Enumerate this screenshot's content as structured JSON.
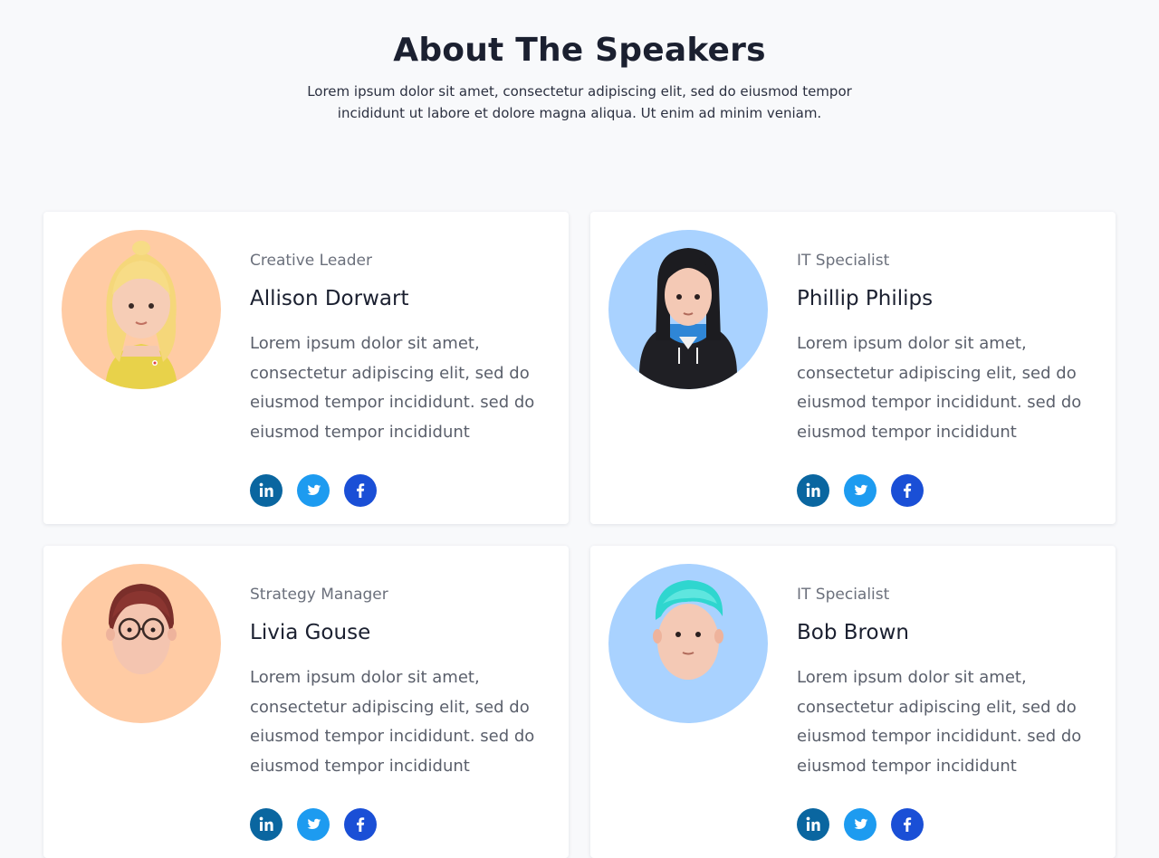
{
  "header": {
    "title": "About The Speakers",
    "subtitle": "Lorem ipsum dolor sit amet, consectetur adipiscing elit, sed do eiusmod tempor incididunt ut labore et dolore magna aliqua. Ut enim ad minim veniam."
  },
  "speakers": [
    {
      "role": "Creative Leader",
      "name": "Allison Dorwart",
      "bio": "Lorem ipsum dolor sit amet, consectetur adipiscing elit, sed do eiusmod tempor incididunt. sed do eiusmod tempor incididunt",
      "avatar_bg": "#ffcba4"
    },
    {
      "role": "IT Specialist",
      "name": "Phillip Philips",
      "bio": "Lorem ipsum dolor sit amet, consectetur adipiscing elit, sed do eiusmod tempor incididunt. sed do eiusmod tempor incididunt",
      "avatar_bg": "#a9d2ff"
    },
    {
      "role": "Strategy Manager",
      "name": "Livia Gouse",
      "bio": "Lorem ipsum dolor sit amet, consectetur adipiscing elit, sed do eiusmod tempor incididunt. sed do eiusmod tempor incididunt",
      "avatar_bg": "#ffcba4"
    },
    {
      "role": "IT Specialist",
      "name": "Bob Brown",
      "bio": "Lorem ipsum dolor sit amet, consectetur adipiscing elit, sed do eiusmod tempor incididunt. sed do eiusmod tempor incididunt",
      "avatar_bg": "#a9d2ff"
    }
  ],
  "social_icons": [
    "linkedin-icon",
    "twitter-icon",
    "facebook-icon"
  ],
  "colors": {
    "linkedin": "#0a66a0",
    "twitter": "#1d9bf0",
    "facebook": "#1a4fd6",
    "page_bg": "#f8f9fb"
  }
}
